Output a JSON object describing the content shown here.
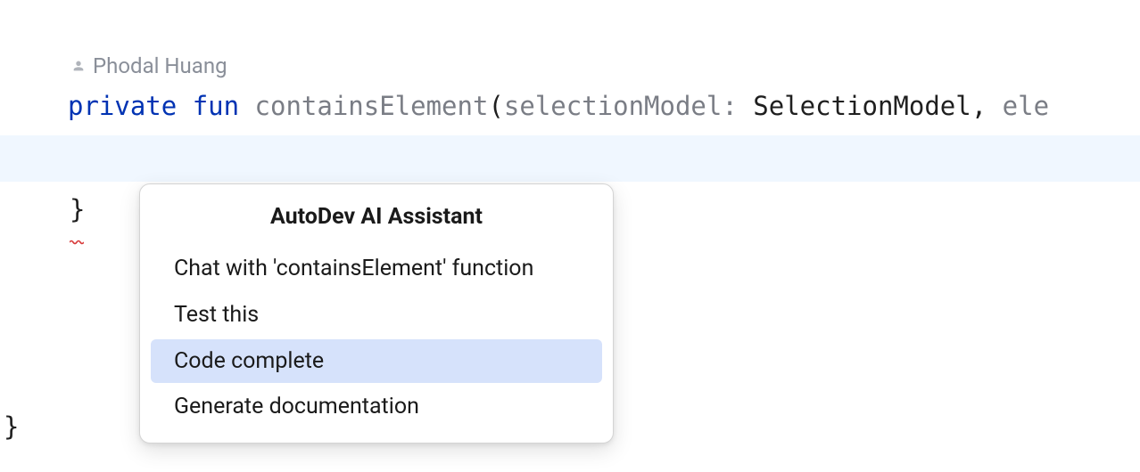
{
  "author": {
    "name": "Phodal Huang"
  },
  "code": {
    "kw_private": "private",
    "kw_fun": "fun",
    "fn_name": "containsElement",
    "paren_open": "(",
    "param1": "selectionModel",
    "colon": ":",
    "space": " ",
    "type1": "SelectionModel",
    "comma": ",",
    "param2_partial": "ele",
    "brace_close_inner": "}",
    "brace_close_outer": "}"
  },
  "popup": {
    "title": "AutoDev AI Assistant",
    "items": [
      {
        "label": "Chat with 'containsElement' function",
        "selected": false
      },
      {
        "label": "Test this",
        "selected": false
      },
      {
        "label": "Code complete",
        "selected": true
      },
      {
        "label": "Generate documentation",
        "selected": false
      }
    ]
  }
}
